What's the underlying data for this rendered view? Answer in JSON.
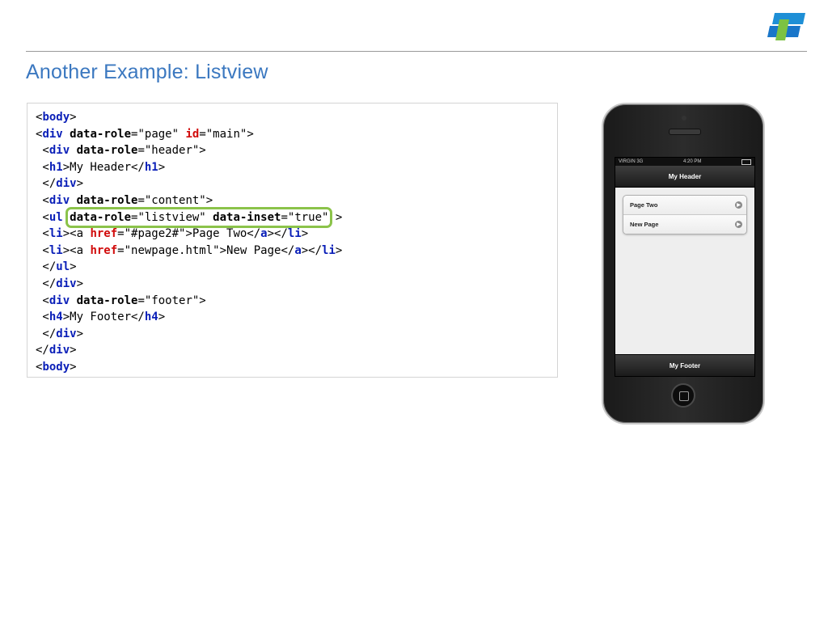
{
  "slide": {
    "title": "Another Example: Listview",
    "logo_icon": "corporate-logo-icon",
    "accent_color": "#3b78c0",
    "highlight_color": "#8bc34a"
  },
  "code": {
    "lines": [
      [
        {
          "t": "<",
          "c": ""
        },
        {
          "t": "body",
          "c": "tg"
        },
        {
          "t": ">",
          "c": ""
        }
      ],
      [
        {
          "t": "<",
          "c": ""
        },
        {
          "t": "div",
          "c": "tg"
        },
        {
          "t": " ",
          "c": ""
        },
        {
          "t": "data-role",
          "c": "at"
        },
        {
          "t": "=\"page\" ",
          "c": ""
        },
        {
          "t": "id",
          "c": "red"
        },
        {
          "t": "=\"main\">",
          "c": ""
        }
      ],
      [
        {
          "t": " <",
          "c": ""
        },
        {
          "t": "div",
          "c": "tg"
        },
        {
          "t": " ",
          "c": ""
        },
        {
          "t": "data-role",
          "c": "at"
        },
        {
          "t": "=\"header\">",
          "c": ""
        }
      ],
      [
        {
          "t": " <",
          "c": ""
        },
        {
          "t": "h1",
          "c": "tg"
        },
        {
          "t": ">My Header</",
          "c": ""
        },
        {
          "t": "h1",
          "c": "tg"
        },
        {
          "t": ">",
          "c": ""
        }
      ],
      [
        {
          "t": " </",
          "c": ""
        },
        {
          "t": "div",
          "c": "tg"
        },
        {
          "t": ">",
          "c": ""
        }
      ],
      [
        {
          "t": " <",
          "c": ""
        },
        {
          "t": "div",
          "c": "tg"
        },
        {
          "t": " ",
          "c": ""
        },
        {
          "t": "data-role",
          "c": "at"
        },
        {
          "t": "=\"content\">",
          "c": ""
        }
      ],
      [
        {
          "t": " <",
          "c": ""
        },
        {
          "t": "ul",
          "c": "tg"
        },
        {
          "t": " ",
          "c": ""
        },
        {
          "t": "data-role",
          "c": "at hl-start"
        },
        {
          "t": "=\"listview\" ",
          "c": "hl-mid"
        },
        {
          "t": "data-inset",
          "c": "at hl-mid"
        },
        {
          "t": "=\"true\"",
          "c": "hl-end"
        },
        {
          "t": " >",
          "c": ""
        }
      ],
      [
        {
          "t": " <",
          "c": ""
        },
        {
          "t": "li",
          "c": "tg"
        },
        {
          "t": "><a ",
          "c": ""
        },
        {
          "t": "href",
          "c": "red"
        },
        {
          "t": "=\"#page2#\">Page Two</",
          "c": ""
        },
        {
          "t": "a",
          "c": "tg"
        },
        {
          "t": "></",
          "c": ""
        },
        {
          "t": "li",
          "c": "tg"
        },
        {
          "t": ">",
          "c": ""
        }
      ],
      [
        {
          "t": " <",
          "c": ""
        },
        {
          "t": "li",
          "c": "tg"
        },
        {
          "t": "><a ",
          "c": ""
        },
        {
          "t": "href",
          "c": "red"
        },
        {
          "t": "=\"newpage.html\">New Page</",
          "c": ""
        },
        {
          "t": "a",
          "c": "tg"
        },
        {
          "t": "></",
          "c": ""
        },
        {
          "t": "li",
          "c": "tg"
        },
        {
          "t": ">",
          "c": ""
        }
      ],
      [
        {
          "t": " </",
          "c": ""
        },
        {
          "t": "ul",
          "c": "tg"
        },
        {
          "t": ">",
          "c": ""
        }
      ],
      [
        {
          "t": " </",
          "c": ""
        },
        {
          "t": "div",
          "c": "tg"
        },
        {
          "t": ">",
          "c": ""
        }
      ],
      [
        {
          "t": " <",
          "c": ""
        },
        {
          "t": "div",
          "c": "tg"
        },
        {
          "t": " ",
          "c": ""
        },
        {
          "t": "data-role",
          "c": "at"
        },
        {
          "t": "=\"footer\">",
          "c": ""
        }
      ],
      [
        {
          "t": " <",
          "c": ""
        },
        {
          "t": "h4",
          "c": "tg"
        },
        {
          "t": ">My Footer</",
          "c": ""
        },
        {
          "t": "h4",
          "c": "tg"
        },
        {
          "t": ">",
          "c": ""
        }
      ],
      [
        {
          "t": " </",
          "c": ""
        },
        {
          "t": "div",
          "c": "tg"
        },
        {
          "t": ">",
          "c": ""
        }
      ],
      [
        {
          "t": "</",
          "c": ""
        },
        {
          "t": "div",
          "c": "tg"
        },
        {
          "t": ">",
          "c": ""
        }
      ],
      [
        {
          "t": "<",
          "c": ""
        },
        {
          "t": "body",
          "c": "tg"
        },
        {
          "t": ">",
          "c": ""
        }
      ]
    ]
  },
  "phone": {
    "status": {
      "carrier": "VIRGIN 3G",
      "time": "4:20 PM"
    },
    "header": "My Header",
    "list_items": [
      {
        "label": "Page Two",
        "icon": "chevron-right-icon"
      },
      {
        "label": "New Page",
        "icon": "chevron-right-icon"
      }
    ],
    "footer": "My Footer",
    "home_icon": "home-button-icon"
  }
}
